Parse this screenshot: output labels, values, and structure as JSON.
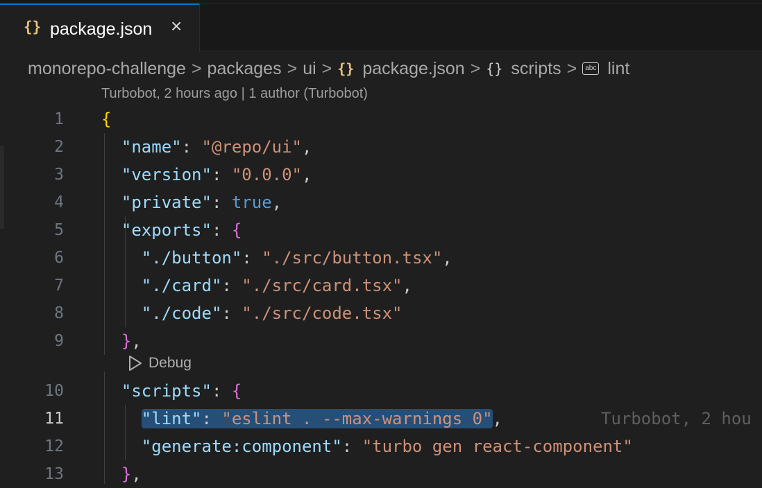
{
  "tab": {
    "icon": "{}",
    "label": "package.json",
    "close": "×"
  },
  "breadcrumb": {
    "items": [
      "monorepo-challenge",
      "packages",
      "ui",
      "package.json",
      "scripts",
      "lint"
    ],
    "json_icon": "{}",
    "object_icon": "{}",
    "string_icon_text": "abc",
    "sep": ">"
  },
  "codelens": {
    "blame": "Turbobot, 2 hours ago | 1 author (Turbobot)",
    "debug": "Debug"
  },
  "inline_blame": "Turbobot, 2 hou",
  "active_line": 11,
  "lines": [
    {
      "n": "1",
      "text": "{"
    },
    {
      "n": "2",
      "text": "  \"name\": \"@repo/ui\","
    },
    {
      "n": "3",
      "text": "  \"version\": \"0.0.0\","
    },
    {
      "n": "4",
      "text": "  \"private\": true,"
    },
    {
      "n": "5",
      "text": "  \"exports\": {"
    },
    {
      "n": "6",
      "text": "    \"./button\": \"./src/button.tsx\","
    },
    {
      "n": "7",
      "text": "    \"./card\": \"./src/card.tsx\","
    },
    {
      "n": "8",
      "text": "    \"./code\": \"./src/code.tsx\""
    },
    {
      "n": "9",
      "text": "  },"
    },
    {
      "n": "10",
      "text": "  \"scripts\": {"
    },
    {
      "n": "11",
      "text": "    \"lint\": \"eslint . --max-warnings 0\","
    },
    {
      "n": "12",
      "text": "    \"generate:component\": \"turbo gen react-component\""
    },
    {
      "n": "13",
      "text": "  },"
    }
  ],
  "tokens": {
    "k_name": "\"name\"",
    "v_name": "\"@repo/ui\"",
    "k_version": "\"version\"",
    "v_version": "\"0.0.0\"",
    "k_private": "\"private\"",
    "v_private": "true",
    "k_exports": "\"exports\"",
    "k_button": "\"./button\"",
    "v_button": "\"./src/button.tsx\"",
    "k_card": "\"./card\"",
    "v_card": "\"./src/card.tsx\"",
    "k_code": "\"./code\"",
    "v_code": "\"./src/code.tsx\"",
    "k_scripts": "\"scripts\"",
    "k_lint": "\"lint\"",
    "v_lint": "\"eslint . --max-warnings 0\"",
    "k_gen": "\"generate:component\"",
    "v_gen": "\"turbo gen react-component\""
  },
  "colors": {
    "accent": "#0078d4",
    "editor_bg": "#1f1f1f",
    "key": "#9cdcfe",
    "string": "#ce9178",
    "keyword": "#569cd6",
    "bracket_1": "#ffd700",
    "bracket_2": "#da70d6",
    "selection": "#264f78"
  }
}
